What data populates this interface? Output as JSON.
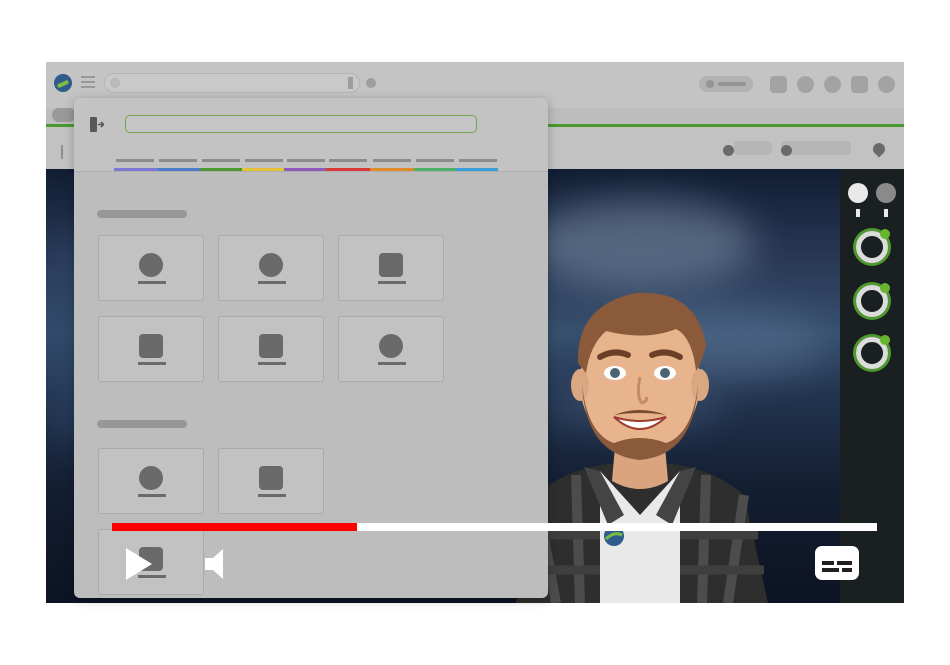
{
  "window": {
    "brand_logo": "globe-logo",
    "menu_icon": "hamburger-icon",
    "accent_color": "#4a9a2f"
  },
  "overlay_panel": {
    "close_icon": "exit-icon",
    "tab_colors": [
      "#7a7ad6",
      "#4a7cc8",
      "#4a9a2f",
      "#e3c23a",
      "#8f5bb8",
      "#d83a3a",
      "#e08a2a",
      "#4fb06a",
      "#3a9fd8"
    ],
    "section_1_tiles": [
      "person-icon",
      "person-icon",
      "document-icon",
      "document-icon",
      "document-icon",
      "person-icon"
    ],
    "section_2_tiles": [
      "person-icon",
      "document-icon",
      "document-icon"
    ]
  },
  "player": {
    "progress_fraction": 0.32,
    "progress_color": "#ff0000",
    "play_icon": "play-icon",
    "volume_icon": "speaker-icon",
    "captions_icon": "captions-icon"
  },
  "right_rail": {
    "icons": [
      "profile-ring-icon",
      "profile-ring-icon",
      "profile-ring-icon"
    ]
  }
}
